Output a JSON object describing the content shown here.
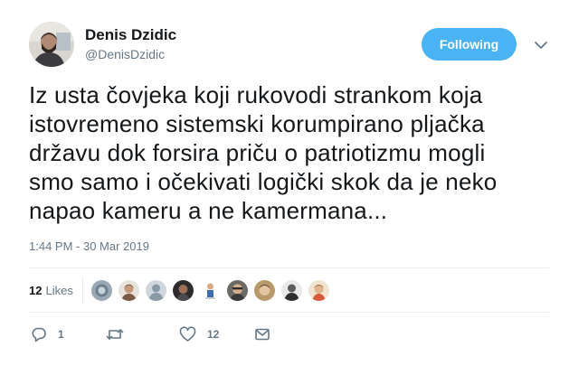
{
  "tweet": {
    "author": {
      "name": "Denis Dzidic",
      "handle": "@DenisDzidic",
      "avatar_icon": "user-photo-avatar"
    },
    "follow_button_label": "Following",
    "menu_icon": "chevron-down-icon",
    "text": "Iz usta čovjeka koji rukovodi strankom koja\nistovremeno sistemski korumpirano pljačka\ndržavu dok forsira priču o patriotizmu mogli\nsmo samo i očekivati logički skok da je neko\nnapao kameru a ne kamermana...",
    "timestamp": "1:44 PM - 30 Mar 2019",
    "likes": {
      "count": "12",
      "label": "Likes",
      "liker_avatars": [
        "liker-avatar-1",
        "liker-avatar-2",
        "liker-avatar-3",
        "liker-avatar-4",
        "liker-avatar-5",
        "liker-avatar-6",
        "liker-avatar-7",
        "liker-avatar-8",
        "liker-avatar-9"
      ]
    },
    "actions": {
      "reply": {
        "icon": "reply-icon",
        "count": "1"
      },
      "retweet": {
        "icon": "retweet-icon",
        "count": ""
      },
      "like": {
        "icon": "heart-icon",
        "count": "12"
      },
      "message": {
        "icon": "envelope-icon",
        "count": ""
      }
    }
  },
  "colors": {
    "accent": "#4ab3f4",
    "text": "#14171a",
    "secondary_text": "#657786",
    "divider": "#e6ecf0"
  }
}
